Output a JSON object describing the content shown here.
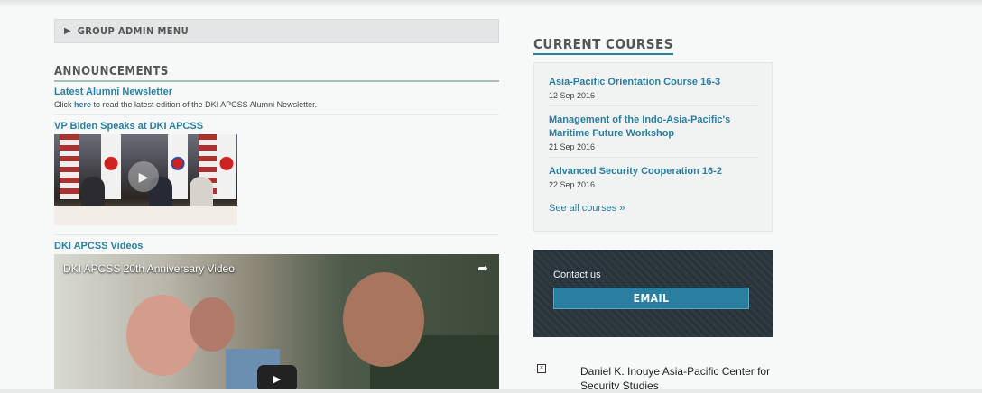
{
  "group_admin": {
    "label": "GROUP ADMIN MENU"
  },
  "announcements": {
    "title": "ANNOUNCEMENTS",
    "newsletter": {
      "title": "Latest Alumni Newsletter",
      "desc_prefix": "Click ",
      "desc_link": "here",
      "desc_suffix": " to read the latest edition of the DKI APCSS Alumni Newsletter."
    },
    "biden": {
      "title": "VP Biden Speaks at DKI APCSS"
    },
    "videos": {
      "title": "DKI APCSS Videos",
      "video_title": "DKI APCSS 20th Anniversary Video"
    }
  },
  "courses": {
    "title": "CURRENT COURSES",
    "items": [
      {
        "name": "Asia-Pacific Orientation Course 16-3",
        "date": "12 Sep 2016"
      },
      {
        "name": "Management of the Indo-Asia-Pacific's Maritime Future Workshop",
        "date": "21 Sep 2016"
      },
      {
        "name": "Advanced Security Cooperation 16-2",
        "date": "22 Sep 2016"
      }
    ],
    "see_all": "See all courses »"
  },
  "contact": {
    "label": "Contact us",
    "email_button": "EMAIL"
  },
  "footer": {
    "name": "Daniel K. Inouye Asia-Pacific Center for Security Studies"
  }
}
